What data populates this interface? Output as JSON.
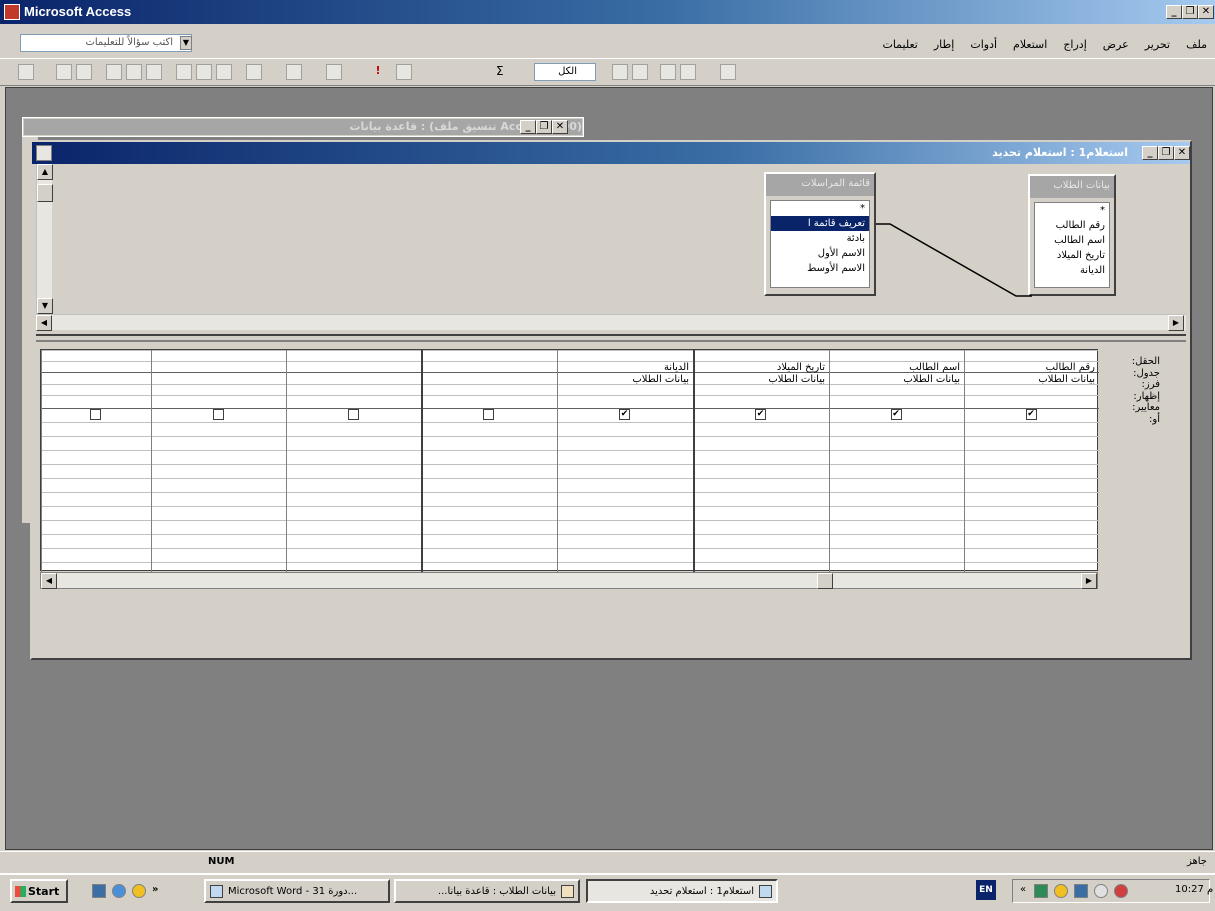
{
  "app": {
    "title": "Microsoft Access"
  },
  "ask_box": {
    "placeholder": "اكتب سؤالاً للتعليمات"
  },
  "menubar": [
    "ملف",
    "تحرير",
    "عرض",
    "إدراج",
    "استعلام",
    "أدوات",
    "إطار",
    "تعليمات"
  ],
  "toolbar": {
    "zoom_value": "الكل"
  },
  "db_window": {
    "title": "(Access 2000 تنسيق ملف) : قاعدة بيانات"
  },
  "query_window": {
    "title": "استعلام1 : استعلام تحديد"
  },
  "field_lists": [
    {
      "title": "بيانات الطلاب",
      "items": [
        "*",
        "رقم الطالب",
        "اسم الطالب",
        "تاريخ الميلاد",
        "الديانة"
      ],
      "selected": -1
    },
    {
      "title": "قائمة المراسلات",
      "items": [
        "*",
        "تعريف قائمة ا",
        "بادئة",
        "الاسم الأول",
        "الاسم الأوسط"
      ],
      "selected": 1
    }
  ],
  "grid": {
    "row_labels": [
      "الحقل:",
      "جدول:",
      "فرز:",
      "إظهار:",
      "معايير:",
      "أو:"
    ],
    "columns": [
      {
        "field": "رقم الطالب",
        "table": "بيانات الطلاب",
        "show": true
      },
      {
        "field": "اسم الطالب",
        "table": "بيانات الطلاب",
        "show": true
      },
      {
        "field": "تاريخ الميلاد",
        "table": "بيانات الطلاب",
        "show": true
      },
      {
        "field": "الديانة",
        "table": "بيانات الطلاب",
        "show": true
      },
      {
        "field": "",
        "table": "",
        "show": false
      },
      {
        "field": "",
        "table": "",
        "show": false
      },
      {
        "field": "",
        "table": "",
        "show": false
      },
      {
        "field": "",
        "table": "",
        "show": false
      }
    ]
  },
  "status": {
    "num": "NUM",
    "mode": "جاهز"
  },
  "taskbar": {
    "start": "Start",
    "tasks": [
      {
        "label": "Microsoft Word - دورة 31...",
        "active": false
      },
      {
        "label": "بيانات الطلاب : قاعدة بيانا...",
        "active": false
      },
      {
        "label": "استعلام1 : استعلام تحديد",
        "active": true
      }
    ],
    "lang": "EN",
    "clock": "10:27 م"
  }
}
